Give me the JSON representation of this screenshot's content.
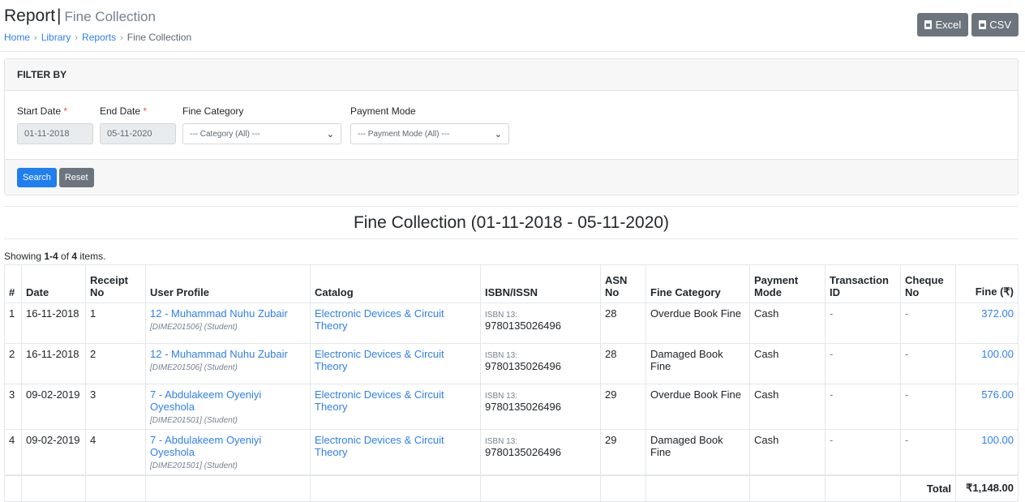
{
  "header": {
    "title": "Report",
    "subtitle": "Fine Collection",
    "breadcrumb": [
      {
        "label": "Home",
        "link": true
      },
      {
        "label": "Library",
        "link": true
      },
      {
        "label": "Reports",
        "link": true
      },
      {
        "label": "Fine Collection",
        "link": false
      }
    ],
    "export_buttons": {
      "excel": "Excel",
      "csv": "CSV"
    }
  },
  "filter": {
    "heading": "FILTER BY",
    "start_date": {
      "label": "Start Date",
      "required_mark": "*",
      "value": "01-11-2018"
    },
    "end_date": {
      "label": "End Date",
      "required_mark": "*",
      "value": "05-11-2020"
    },
    "fine_category": {
      "label": "Fine Category",
      "selected": "--- Category (All) ---"
    },
    "payment_mode": {
      "label": "Payment Mode",
      "selected": "--- Payment Mode (All) ---"
    },
    "search_label": "Search",
    "reset_label": "Reset"
  },
  "report": {
    "title": "Fine Collection (01-11-2018 - 05-11-2020)",
    "summary": {
      "prefix": "Showing ",
      "range": "1-4",
      "mid": " of ",
      "total": "4",
      "suffix": " items."
    },
    "columns": [
      "#",
      "Date",
      "Receipt No",
      "User Profile",
      "Catalog",
      "ISBN/ISSN",
      "ASN No",
      "Fine Category",
      "Payment Mode",
      "Transaction ID",
      "Cheque No",
      "Fine (₹)"
    ],
    "rows": [
      {
        "n": "1",
        "date": "16-11-2018",
        "receipt": "1",
        "user": "12 - Muhammad Nuhu Zubair",
        "user_meta": "[DIME201506] (Student)",
        "catalog": "Electronic Devices & Circuit Theory",
        "isbn_prefix": "ISBN 13:",
        "isbn": "9780135026496",
        "asn": "28",
        "category": "Overdue Book Fine",
        "mode": "Cash",
        "txn": "-",
        "cheque": "-",
        "fine": "372.00"
      },
      {
        "n": "2",
        "date": "16-11-2018",
        "receipt": "2",
        "user": "12 - Muhammad Nuhu Zubair",
        "user_meta": "[DIME201506] (Student)",
        "catalog": "Electronic Devices & Circuit Theory",
        "isbn_prefix": "ISBN 13:",
        "isbn": "9780135026496",
        "asn": "28",
        "category": "Damaged Book Fine",
        "mode": "Cash",
        "txn": "-",
        "cheque": "-",
        "fine": "100.00"
      },
      {
        "n": "3",
        "date": "09-02-2019",
        "receipt": "3",
        "user": "7 - Abdulakeem Oyeniyi Oyeshola",
        "user_meta": "[DIME201501] (Student)",
        "catalog": "Electronic Devices & Circuit Theory",
        "isbn_prefix": "ISBN 13:",
        "isbn": "9780135026496",
        "asn": "29",
        "category": "Overdue Book Fine",
        "mode": "Cash",
        "txn": "-",
        "cheque": "-",
        "fine": "576.00"
      },
      {
        "n": "4",
        "date": "09-02-2019",
        "receipt": "4",
        "user": "7 - Abdulakeem Oyeniyi Oyeshola",
        "user_meta": "[DIME201501] (Student)",
        "catalog": "Electronic Devices & Circuit Theory",
        "isbn_prefix": "ISBN 13:",
        "isbn": "9780135026496",
        "asn": "29",
        "category": "Damaged Book Fine",
        "mode": "Cash",
        "txn": "-",
        "cheque": "-",
        "fine": "100.00"
      }
    ],
    "footer": {
      "label": "Total",
      "value": "₹1,148.00"
    }
  }
}
